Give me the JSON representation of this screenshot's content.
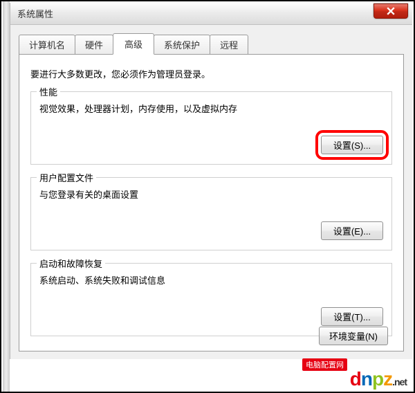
{
  "window": {
    "title": "系统属性"
  },
  "tabs": [
    {
      "label": "计算机名"
    },
    {
      "label": "硬件"
    },
    {
      "label": "高级",
      "active": true
    },
    {
      "label": "系统保护"
    },
    {
      "label": "远程"
    }
  ],
  "intro": "要进行大多数更改，您必须作为管理员登录。",
  "groups": {
    "performance": {
      "title": "性能",
      "desc": "视觉效果，处理器计划，内存使用，以及虚拟内存",
      "button": "设置(S)..."
    },
    "userprofile": {
      "title": "用户配置文件",
      "desc": "与您登录有关的桌面设置",
      "button": "设置(E)..."
    },
    "startup": {
      "title": "启动和故障恢复",
      "desc": "系统启动、系统失败和调试信息",
      "button": "设置(T)..."
    }
  },
  "env_button": "环境变量(N)",
  "watermark": {
    "label": "电脑配置网",
    "domain": ".net"
  }
}
